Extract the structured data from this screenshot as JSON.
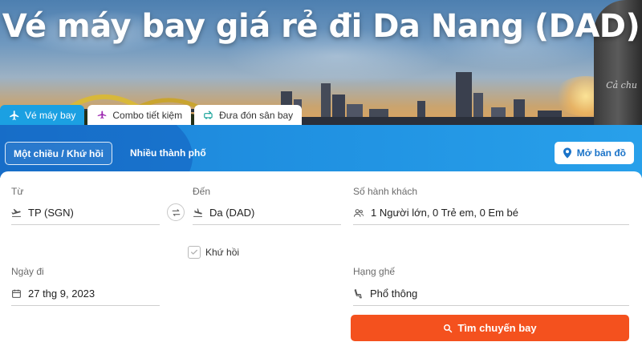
{
  "hero": {
    "title": "Vé máy bay giá rẻ đi Da Nang (DAD)",
    "statue_caption": "Cả chu"
  },
  "tabs": [
    {
      "label": "Vé máy bay",
      "icon": "airplane-icon",
      "active": true
    },
    {
      "label": "Combo tiết kiệm",
      "icon": "combo-plane-hotel-icon",
      "active": false
    },
    {
      "label": "Đưa đón sân bay",
      "icon": "airport-transfer-icon",
      "active": false
    }
  ],
  "band": {
    "trip_mode": "Một chiều / Khứ hồi",
    "multi_city": "Nhiều thành phố",
    "map_button": "Mở bản đồ"
  },
  "form": {
    "from": {
      "label": "Từ",
      "value": "TP (SGN)"
    },
    "to": {
      "label": "Đến",
      "value": "Da (DAD)"
    },
    "passengers": {
      "label": "Số hành khách",
      "value": "1 Người lớn, 0 Trẻ em, 0 Em bé"
    },
    "round_trip": {
      "label": "Khứ hồi",
      "checked": false
    },
    "depart_date": {
      "label": "Ngày đi",
      "value": "27 thg 9, 2023"
    },
    "seat_class": {
      "label": "Hạng ghế",
      "value": "Phổ thông"
    },
    "search_button": "Tìm chuyến bay"
  },
  "colors": {
    "tab_active": "#1ba0e2",
    "band_blue": "#1f8fe0",
    "search_orange": "#f4511e",
    "map_text": "#1a73c8"
  }
}
